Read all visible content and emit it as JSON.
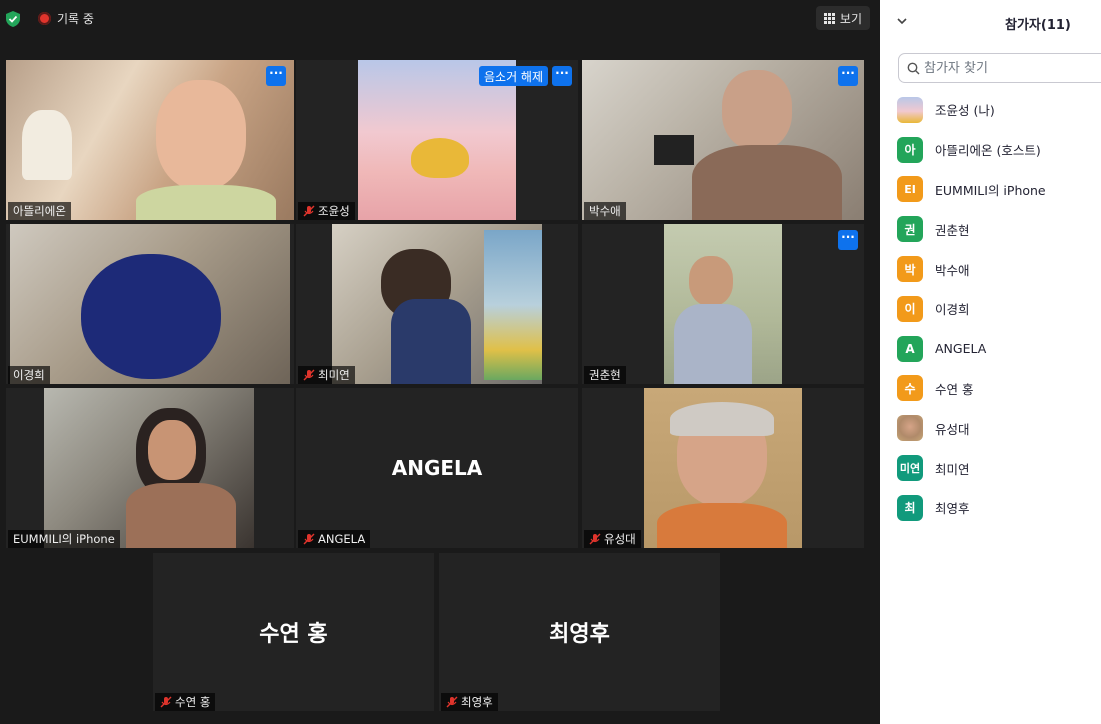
{
  "meeting": {
    "recording_label": "기록 중",
    "view_label": "보기",
    "more_label": "···",
    "unmute_label": "음소거 해제",
    "tiles": [
      {
        "name": "아뜰리에온",
        "muted": false
      },
      {
        "name": "조윤성",
        "muted": true
      },
      {
        "name": "박수애",
        "muted": false
      },
      {
        "name": "이경희",
        "muted": false
      },
      {
        "name": "최미연",
        "muted": true
      },
      {
        "name": "권춘현",
        "muted": false
      },
      {
        "name": "EUMMILI의 iPhone",
        "muted": false
      },
      {
        "name": "ANGELA",
        "muted": true,
        "big": "ANGELA"
      },
      {
        "name": "유성대",
        "muted": true
      },
      {
        "name": "수연 홍",
        "muted": true,
        "big": "수연 홍"
      },
      {
        "name": "최영후",
        "muted": true,
        "big": "최영후"
      }
    ]
  },
  "panel": {
    "title": "참가자(11)",
    "search_placeholder": "참가자 찾기",
    "participants": [
      {
        "name": "조윤성 (나)",
        "avatar": "",
        "color": "#c8a0c8"
      },
      {
        "name": "아뜰리에온 (호스트)",
        "avatar": "아",
        "color": "#23a55a"
      },
      {
        "name": "EUMMILI의 iPhone",
        "avatar": "EI",
        "color": "#f29a1a"
      },
      {
        "name": "권춘현",
        "avatar": "권",
        "color": "#23a55a"
      },
      {
        "name": "박수애",
        "avatar": "박",
        "color": "#f29a1a"
      },
      {
        "name": "이경희",
        "avatar": "이",
        "color": "#f29a1a"
      },
      {
        "name": "ANGELA",
        "avatar": "A",
        "color": "#23a55a"
      },
      {
        "name": "수연 홍",
        "avatar": "수",
        "color": "#f29a1a"
      },
      {
        "name": "유성대",
        "avatar": "",
        "color": "#b08a6a"
      },
      {
        "name": "최미연",
        "avatar": "미연",
        "color": "#119a7c"
      },
      {
        "name": "최영후",
        "avatar": "최",
        "color": "#119a7c"
      }
    ]
  }
}
